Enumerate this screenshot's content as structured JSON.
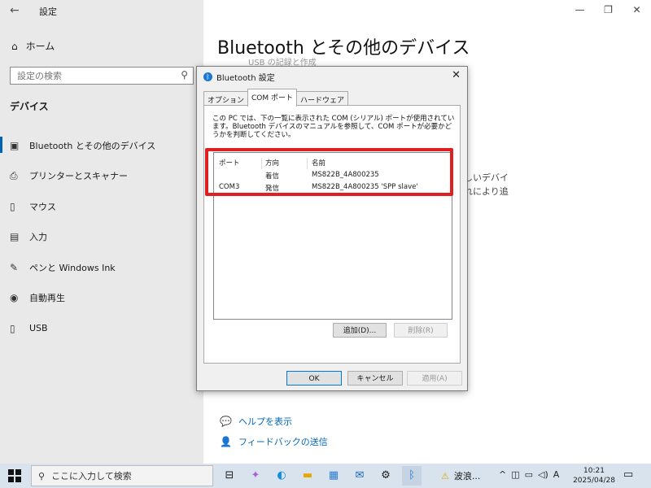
{
  "settings": {
    "back_icon": "←",
    "title": "設定",
    "home": "ホーム",
    "search_placeholder": "設定の検索",
    "section": "デバイス",
    "nav": [
      {
        "label": "Bluetooth とその他のデバイス",
        "icon": "bluetooth-devices-icon"
      },
      {
        "label": "プリンターとスキャナー",
        "icon": "printer-icon"
      },
      {
        "label": "マウス",
        "icon": "mouse-icon"
      },
      {
        "label": "入力",
        "icon": "keyboard-icon"
      },
      {
        "label": "ペンと Windows Ink",
        "icon": "pen-icon"
      },
      {
        "label": "自動再生",
        "icon": "autoplay-icon"
      },
      {
        "label": "USB",
        "icon": "usb-icon"
      }
    ],
    "main_title": "Bluetooth とその他のデバイス",
    "main_sub": "USB の記録と作成",
    "bg_right_line1": "しいデバイ",
    "bg_right_line2": "れにより追",
    "help": "ヘルプを表示",
    "feedback": "フィードバックの送信"
  },
  "dialog": {
    "title": "Bluetooth 設定",
    "tabs": [
      "オプション",
      "COM ポート",
      "ハードウェア"
    ],
    "description": "この PC では、下の一覧に表示された COM (シリアル) ポートが使用されています。Bluetooth デバイスのマニュアルを参照して、COM ポートが必要かどうかを判断してください。",
    "columns": [
      "ポート",
      "方向",
      "名前"
    ],
    "rows": [
      {
        "port": "",
        "direction": "着信",
        "name": "MS822B_4A800235"
      },
      {
        "port": "COM3",
        "direction": "発信",
        "name": "MS822B_4A800235 'SPP slave'"
      }
    ],
    "add_button": "追加(D)...",
    "delete_button": "削除(R)",
    "ok": "OK",
    "cancel": "キャンセル",
    "apply": "適用(A)"
  },
  "taskbar": {
    "search_placeholder": "ここに入力して検索",
    "weather": "波浪...",
    "ime": "A",
    "time": "10:21",
    "date": "2025/04/28"
  }
}
